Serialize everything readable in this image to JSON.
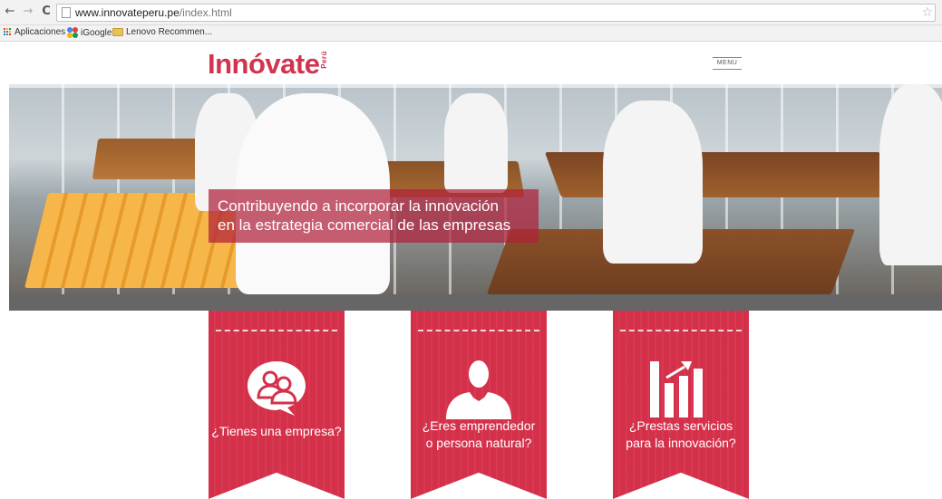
{
  "browser": {
    "url_host": "www.innovateperu.pe",
    "url_path": "/index.html",
    "bookmarks": [
      {
        "label": "Aplicaciones",
        "icon": "apps-grid-icon"
      },
      {
        "label": "iGoogle",
        "icon": "igoogle-icon"
      },
      {
        "label": "Lenovo Recommen...",
        "icon": "folder-icon"
      }
    ]
  },
  "header": {
    "logo_text": "Innóvate",
    "logo_sub": "Perú",
    "menu_label": "MENU"
  },
  "hero": {
    "caption_line1": "Contribuyendo a incorporar la innovación",
    "caption_line2": "en la estrategia comercial de las empresas"
  },
  "ribbons": [
    {
      "line1": "¿Tienes una empresa?",
      "line2": "",
      "icon": "people-chat-icon"
    },
    {
      "line1": "¿Eres emprendedor",
      "line2": "o persona natural?",
      "icon": "person-silhouette-icon"
    },
    {
      "line1": "¿Prestas servicios",
      "line2": "para la innovación?",
      "icon": "growth-chart-icon"
    }
  ],
  "colors": {
    "brand": "#d2334f",
    "ribbon": "#d4304a",
    "caption_bg": "#b0203a",
    "hero_bottom_bar": "#666666"
  }
}
